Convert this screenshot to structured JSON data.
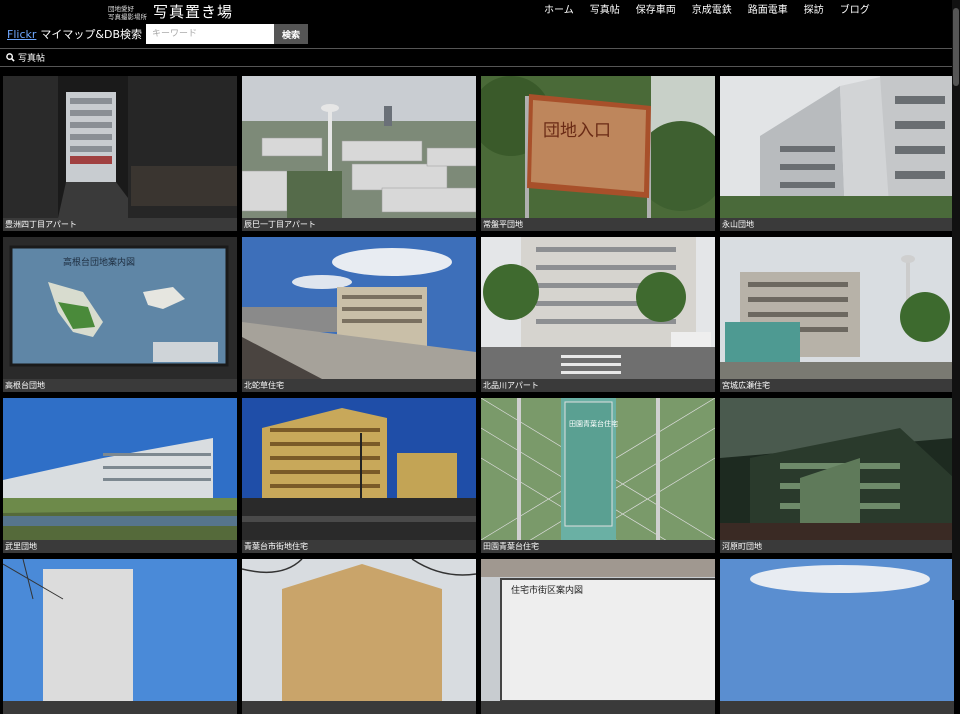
{
  "site": {
    "logo_sub_1": "団地愛好",
    "logo_sub_2": "写真撮影場所",
    "logo_main": "写真置き場"
  },
  "nav": {
    "items": [
      "ホーム",
      "写真帖",
      "保存車両",
      "京成電鉄",
      "路面電車",
      "探訪",
      "ブログ"
    ]
  },
  "search": {
    "flickr_link": "Flickr",
    "label": "マイマップ&DB検索",
    "placeholder": "キーワード",
    "button": "検索"
  },
  "section": {
    "icon": "search-icon",
    "title": "写真帖"
  },
  "photos": [
    {
      "caption": "豊洲四丁目アパート"
    },
    {
      "caption": "辰巳一丁目アパート"
    },
    {
      "caption": "常盤平団地"
    },
    {
      "caption": "永山団地"
    },
    {
      "caption": "高根台団地"
    },
    {
      "caption": "北蛇草住宅"
    },
    {
      "caption": "北品川アパート"
    },
    {
      "caption": "宮城広瀬住宅"
    },
    {
      "caption": "武里団地"
    },
    {
      "caption": "青葉台市街地住宅"
    },
    {
      "caption": "田園青葉台住宅"
    },
    {
      "caption": "河原町団地"
    },
    {
      "caption": ""
    },
    {
      "caption": ""
    },
    {
      "caption": ""
    },
    {
      "caption": ""
    }
  ],
  "photo_text": {
    "sign_3": "団地入口",
    "sign_5": "高根台団地案内図",
    "sign_11": "田園青葉台住宅",
    "sign_14": "住宅市街区案内図"
  }
}
